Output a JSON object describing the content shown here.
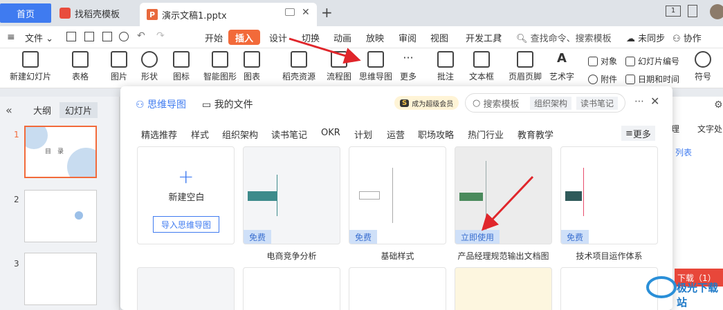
{
  "titlebar": {
    "home_tab": "首页",
    "template_tab": "找稻壳模板",
    "doc_tab": "演示文稿1.pptx",
    "new_tab": "+",
    "window_badge": "1"
  },
  "menubar": {
    "file": "文件",
    "items": [
      "开始",
      "插入",
      "设计",
      "切换",
      "动画",
      "放映",
      "审阅",
      "视图",
      "开发工具"
    ],
    "search": "查找命令、搜索模板",
    "unsynced": "未同步",
    "collab": "协作"
  },
  "ribbon": {
    "new_slide": "新建幻灯片",
    "table": "表格",
    "picture": "图片",
    "shape": "形状",
    "icon": "图标",
    "smart": "智能图形",
    "chart": "图表",
    "daoke": "稻壳资源",
    "flowchart": "流程图",
    "mindmap": "思维导图",
    "more": "更多",
    "comment": "批注",
    "textbox": "文本框",
    "header_footer": "页眉页脚",
    "art_text": "艺术字",
    "object": "对象",
    "slide_number": "幻灯片编号",
    "attachment": "附件",
    "datetime": "日期和时间",
    "symbol": "符号"
  },
  "leftpanel": {
    "collapse": "«",
    "outline": "大纲",
    "slides": "幻灯片",
    "slide_numbers": [
      "1",
      "2",
      "3"
    ],
    "thumb1_title": "目　录"
  },
  "rightarea": {
    "tab1": "理",
    "tab2": "文字处",
    "link": "列表"
  },
  "popup": {
    "tab_mindmap": "思维导图",
    "tab_myfiles": "我的文件",
    "vip": "成为超级会员",
    "search_placeholder": "搜索模板",
    "tag1": "组织架构",
    "tag2": "读书笔记",
    "categories": [
      "精选推荐",
      "样式",
      "组织架构",
      "读书笔记",
      "OKR",
      "计划",
      "运营",
      "职场攻略",
      "热门行业",
      "教育教学"
    ],
    "more": "更多",
    "new_blank": "新建空白",
    "import": "导入思维导图",
    "cards": [
      {
        "label": "电商竞争分析",
        "badge": "免费"
      },
      {
        "label": "基础样式",
        "badge": "免费"
      },
      {
        "label": "产品经理规范输出文档图",
        "badge": "立即使用"
      },
      {
        "label": "技术项目运作体系",
        "badge": "免费"
      }
    ]
  },
  "overlay": {
    "download": "下载（1）",
    "watermark": "极光下载站"
  },
  "colors": {
    "accent": "#3f7bf0",
    "insert_tab": "#f26a3a",
    "arrow": "#e0262b"
  }
}
